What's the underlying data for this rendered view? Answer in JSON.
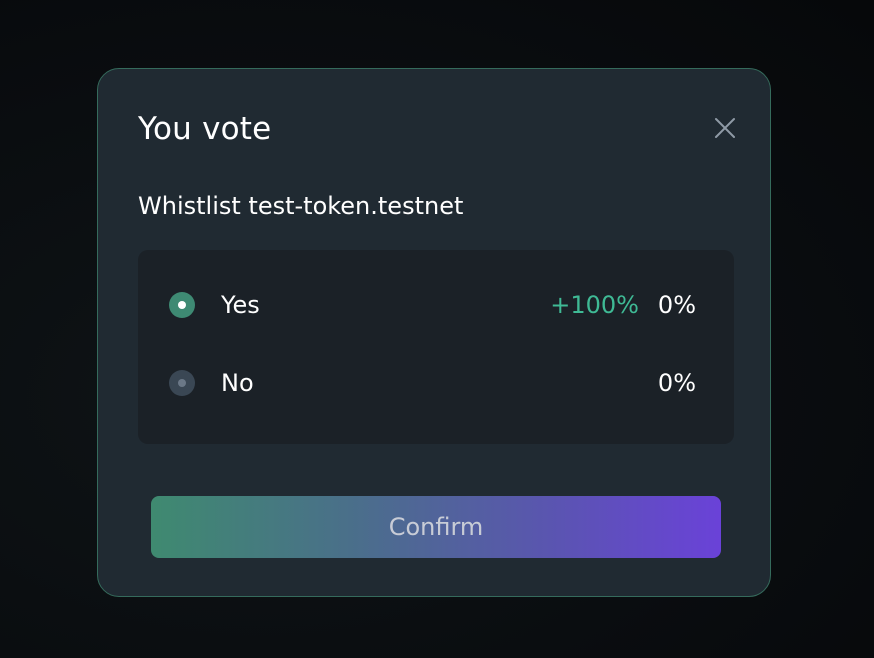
{
  "modal": {
    "title": "You vote",
    "close_icon": "close-icon",
    "proposal": "Whistlist test-token.testnet",
    "options": [
      {
        "label": "Yes",
        "selected": true,
        "change": "+100%",
        "percent": "0%"
      },
      {
        "label": "No",
        "selected": false,
        "change": "",
        "percent": "0%"
      }
    ],
    "confirm_label": "Confirm"
  },
  "colors": {
    "modal_background": "#202a32",
    "modal_border": "#356b5c",
    "panel_background": "#1b2127",
    "accent_green": "#3fba95",
    "radio_checked": "#3e8a73",
    "radio_unchecked": "#3a4754",
    "button_gradient_start": "#3f8a70",
    "button_gradient_end": "#6a42d8"
  }
}
